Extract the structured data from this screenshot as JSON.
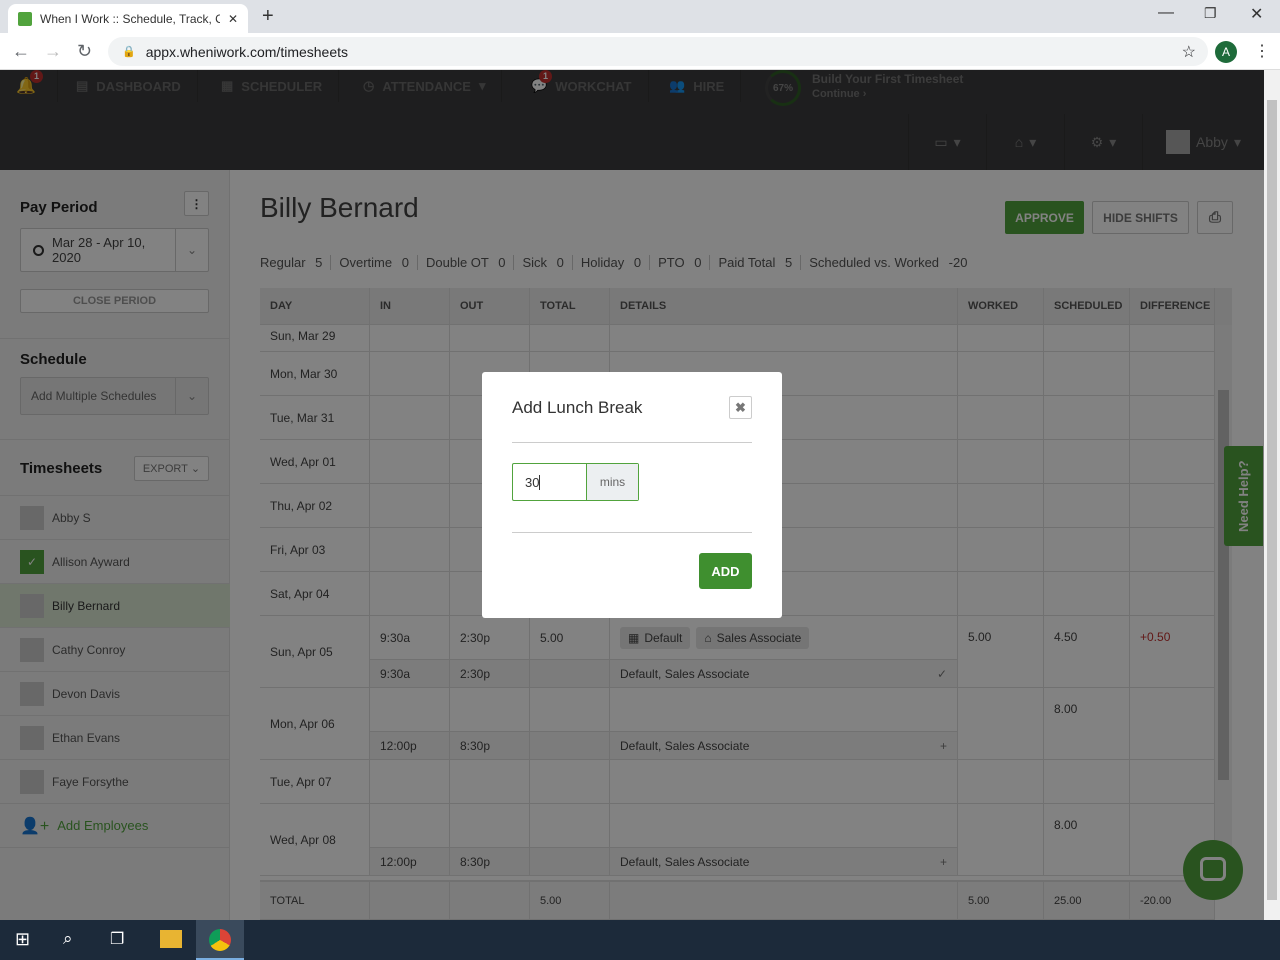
{
  "browser": {
    "tab_title": "When I Work :: Schedule, Track, C",
    "url": "appx.wheniwork.com/timesheets",
    "profile_initial": "A"
  },
  "nav": {
    "notifications_badge": "1",
    "dashboard": "DASHBOARD",
    "scheduler": "SCHEDULER",
    "attendance": "ATTENDANCE",
    "workchat": "WORKCHAT",
    "workchat_badge": "1",
    "hire": "HIRE",
    "progress_label": "67%",
    "progress": 0.67,
    "onboarding_title": "Build Your First Timesheet",
    "onboarding_link": "Continue ›",
    "user": "Abby"
  },
  "sidebar": {
    "pay_period_title": "Pay Period",
    "pay_period_value": "Mar 28 - Apr 10, 2020",
    "close_period": "CLOSE PERIOD",
    "schedule_title": "Schedule",
    "schedule_value": "Add Multiple Schedules",
    "timesheets_title": "Timesheets",
    "export": "EXPORT",
    "employees": [
      {
        "name": "Abby S",
        "state": "none"
      },
      {
        "name": "Allison Ayward",
        "state": "checked"
      },
      {
        "name": "Billy Bernard",
        "state": "selected"
      },
      {
        "name": "Cathy Conroy",
        "state": "none"
      },
      {
        "name": "Devon Davis",
        "state": "none"
      },
      {
        "name": "Ethan Evans",
        "state": "none"
      },
      {
        "name": "Faye Forsythe",
        "state": "none"
      }
    ],
    "add_employees": "Add Employees"
  },
  "main": {
    "employee_name": "Billy Bernard",
    "approve": "APPROVE",
    "hide_shifts": "HIDE SHIFTS",
    "stats": [
      {
        "label": "Regular",
        "value": "5"
      },
      {
        "label": "Overtime",
        "value": "0"
      },
      {
        "label": "Double OT",
        "value": "0"
      },
      {
        "label": "Sick",
        "value": "0"
      },
      {
        "label": "Holiday",
        "value": "0"
      },
      {
        "label": "PTO",
        "value": "0"
      },
      {
        "label": "Paid Total",
        "value": "5"
      },
      {
        "label": "Scheduled vs. Worked",
        "value": "-20"
      }
    ],
    "columns": [
      "DAY",
      "IN",
      "OUT",
      "TOTAL",
      "DETAILS",
      "WORKED",
      "SCHEDULED",
      "DIFFERENCE"
    ],
    "rows": [
      {
        "day": "Sun, Mar 29"
      },
      {
        "day": "Mon, Mar 30"
      },
      {
        "day": "Tue, Mar 31"
      },
      {
        "day": "Wed, Apr 01"
      },
      {
        "day": "Thu, Apr 02"
      },
      {
        "day": "Fri, Apr 03"
      },
      {
        "day": "Sat, Apr 04"
      },
      {
        "day": "Sun, Apr 05",
        "in": "9:30a",
        "out": "2:30p",
        "total": "5.00",
        "chips": [
          "Default",
          "Sales Associate"
        ],
        "worked": "5.00",
        "scheduled": "4.50",
        "difference": "+0.50",
        "shift": {
          "in": "9:30a",
          "out": "2:30p",
          "details": "Default, Sales Associate",
          "action": "✓"
        }
      },
      {
        "day": "Mon, Apr 06",
        "scheduled": "8.00",
        "shift": {
          "in": "12:00p",
          "out": "8:30p",
          "details": "Default, Sales Associate",
          "action": "+"
        }
      },
      {
        "day": "Tue, Apr 07"
      },
      {
        "day": "Wed, Apr 08",
        "scheduled": "8.00",
        "shift": {
          "in": "12:00p",
          "out": "8:30p",
          "details": "Default, Sales Associate",
          "action": "+"
        }
      }
    ],
    "totals": {
      "label": "TOTAL",
      "total": "5.00",
      "worked": "5.00",
      "scheduled": "25.00",
      "difference": "-20.00"
    },
    "need_help": "Need Help?"
  },
  "modal": {
    "title": "Add Lunch Break",
    "input_value": "30",
    "unit": "mins",
    "add": "ADD"
  },
  "colors": {
    "brand": "#51a33d",
    "negative": "#c0302e"
  }
}
